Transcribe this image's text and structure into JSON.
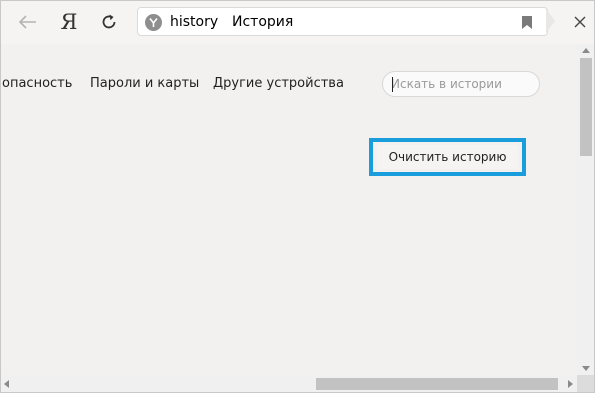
{
  "toolbar": {
    "back_icon": "arrow-left-icon",
    "yandex_label": "Я",
    "reload_icon": "reload-icon",
    "address": {
      "site_icon": "yandex-browser-icon",
      "host": "history",
      "title": "История"
    },
    "bookmark_icon": "bookmark-icon",
    "close_icon": "close-icon"
  },
  "nav": {
    "security": "опасность",
    "passwords": "Пароли и карты",
    "devices": "Другие устройства"
  },
  "search": {
    "placeholder": "Искать в истории"
  },
  "actions": {
    "clear_history": "Очистить историю"
  },
  "colors": {
    "highlight": "#1a9ddc",
    "background": "#f2f1f0"
  }
}
